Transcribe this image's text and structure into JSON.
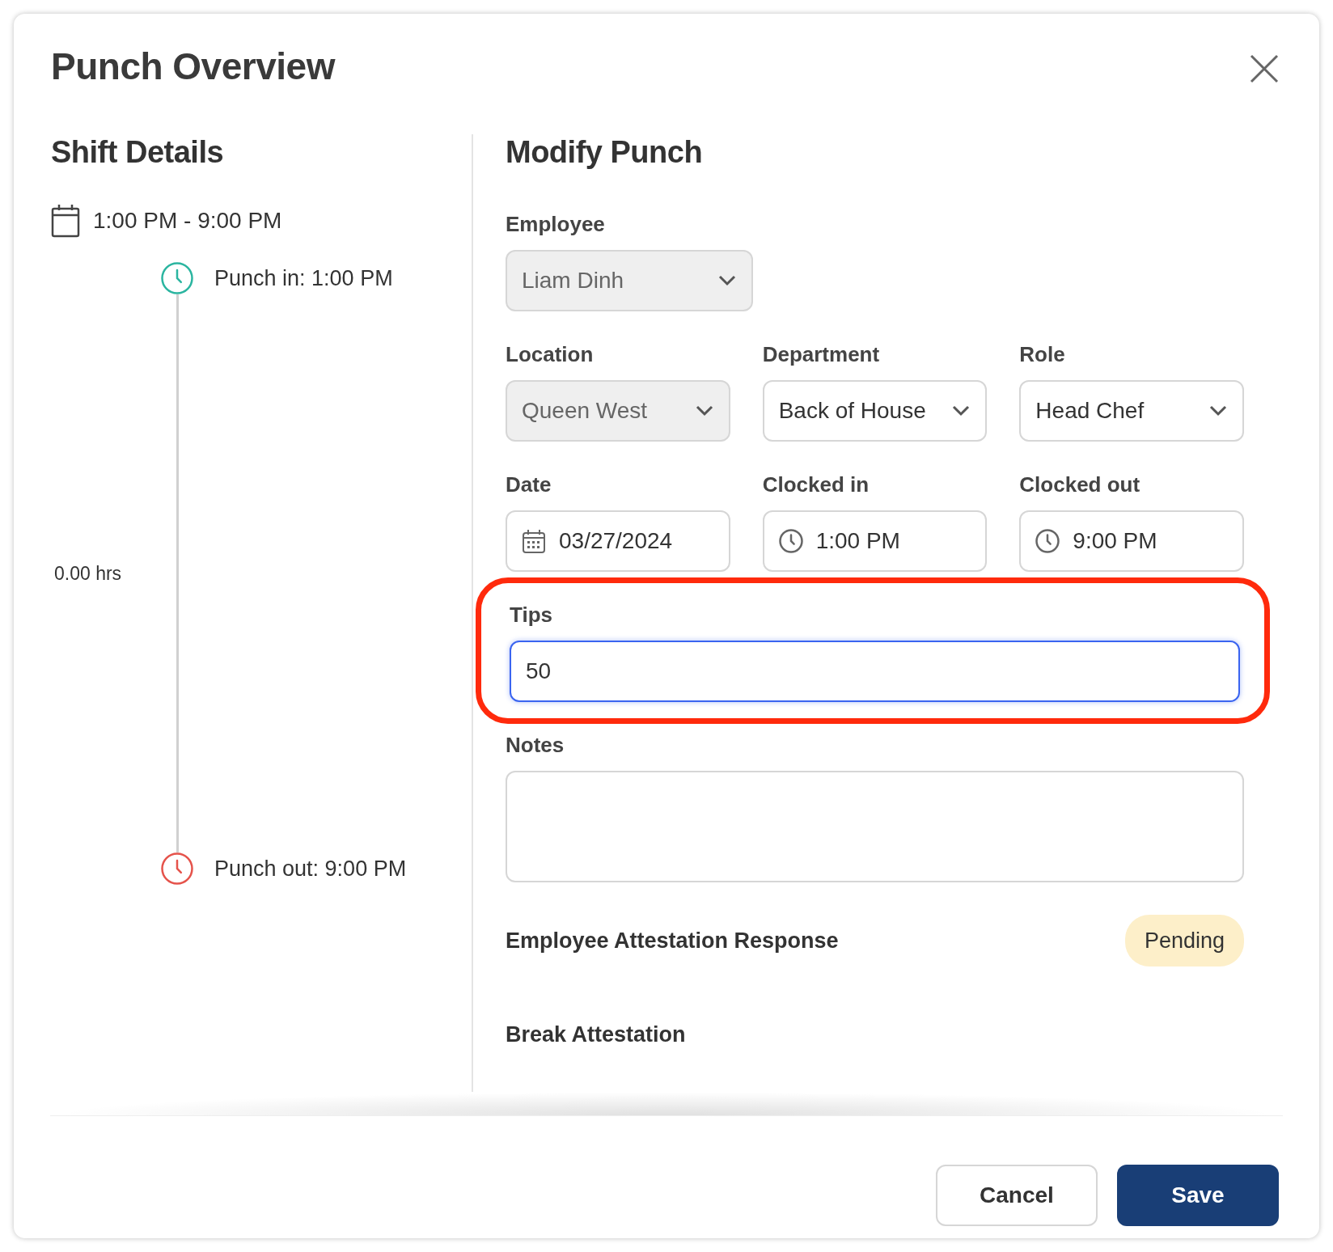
{
  "dialog": {
    "title": "Punch Overview"
  },
  "shift_details": {
    "heading": "Shift Details",
    "shift_time": "1:00 PM - 9:00 PM",
    "timeline": [
      {
        "label": "Punch in: 1:00 PM",
        "color": "#2bb5a0"
      },
      {
        "label": "Punch out: 9:00 PM",
        "color": "#e5534b"
      }
    ],
    "duration": "0.00 hrs"
  },
  "modify_punch": {
    "heading": "Modify Punch",
    "rows": [
      [
        {
          "kind": "select",
          "label": "Employee",
          "value": "Liam Dinh",
          "disabled": true
        }
      ],
      [
        {
          "kind": "select",
          "label": "Location",
          "value": "Queen West",
          "disabled": true
        },
        {
          "kind": "select",
          "label": "Department",
          "value": "Back of House",
          "disabled": false
        },
        {
          "kind": "select",
          "label": "Role",
          "value": "Head Chef",
          "disabled": false
        }
      ],
      [
        {
          "kind": "date",
          "label": "Date",
          "value": "03/27/2024",
          "disabled": false
        },
        {
          "kind": "time",
          "label": "Clocked in",
          "value": "1:00 PM",
          "disabled": false
        },
        {
          "kind": "time",
          "label": "Clocked out",
          "value": "9:00 PM",
          "disabled": false
        }
      ],
      [
        {
          "kind": "text",
          "label": "Tips",
          "value": "50",
          "disabled": false,
          "focused": true,
          "highlighted": true
        }
      ],
      [
        {
          "kind": "textarea",
          "label": "Notes",
          "disabled": false
        }
      ]
    ],
    "attestation": {
      "label": "Employee Attestation Response",
      "status": "Pending",
      "color": "#fdefc9"
    },
    "break_attestation": "Break Attestation"
  },
  "buttons": [
    {
      "kind": "secondary",
      "label": "Cancel"
    },
    {
      "kind": "primary",
      "label": "Save"
    }
  ]
}
